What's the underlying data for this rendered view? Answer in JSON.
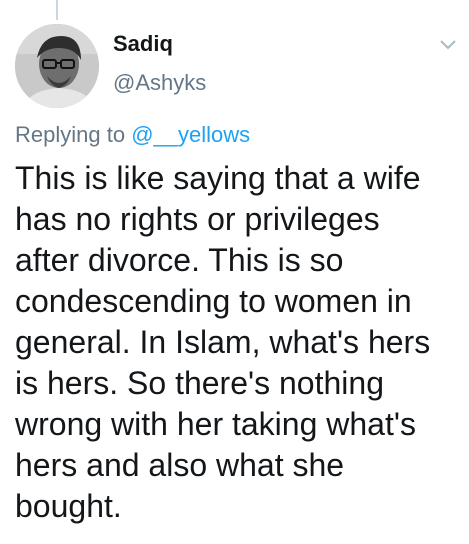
{
  "tweet": {
    "author": {
      "display_name": "Sadiq",
      "handle": "@Ashyks",
      "avatar_icon": "user-photo-icon"
    },
    "menu_icon": "chevron-down-icon",
    "replying_to": {
      "prefix": "Replying to",
      "mention": "@__yellows"
    },
    "text_lines": [
      "This is like saying that a wife",
      "has no rights or privileges",
      "after divorce. This is so",
      "condescending to women in",
      "general. In Islam, what's hers",
      "is hers. So there's nothing",
      "wrong with her taking what's",
      "hers and also what she",
      "bought."
    ]
  },
  "colors": {
    "text": "#14171a",
    "secondary": "#657786",
    "link": "#1da1f2",
    "thread_line": "#ccd6dd"
  }
}
